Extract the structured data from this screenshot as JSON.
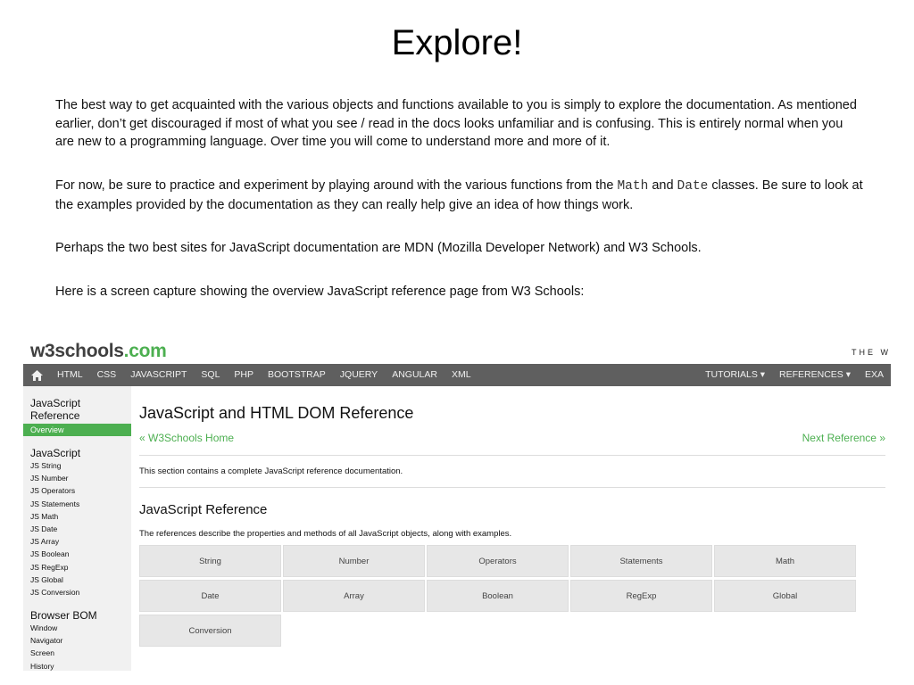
{
  "slide": {
    "title": "Explore!",
    "p1": "The best way to get acquainted with the various objects and functions available to you is simply to explore the documentation. As mentioned earlier, don’t get discouraged if most of what you see / read in the docs looks unfamiliar and is confusing. This is entirely normal when you are new to a programming language. Over time you will come to understand more and more of it.",
    "p2_before": "For now, be sure to practice and experiment by playing around with the various functions from the ",
    "p2_code1": "Math",
    "p2_and": " and ",
    "p2_code2": "Date",
    "p2_after": " classes. Be sure to look at the examples provided by the documentation as they can really help give an idea of how things work.",
    "p3": "Perhaps the two best sites for JavaScript documentation are MDN (Mozilla Developer Network) and W3 Schools.",
    "p4": "Here is a screen capture showing the overview JavaScript reference page from W3 Schools:"
  },
  "w3": {
    "logo_main": "w3schools",
    "logo_tld": ".com",
    "tagline": "THE W",
    "nav_left": [
      "HTML",
      "CSS",
      "JAVASCRIPT",
      "SQL",
      "PHP",
      "BOOTSTRAP",
      "JQUERY",
      "ANGULAR",
      "XML"
    ],
    "nav_right": [
      "TUTORIALS ▾",
      "REFERENCES ▾",
      "EXA"
    ],
    "accent_color": "#4CAF50",
    "sidebar": {
      "heading": "JavaScript Reference",
      "active": "Overview",
      "section1": "JavaScript",
      "items1": [
        "JS String",
        "JS Number",
        "JS Operators",
        "JS Statements",
        "JS Math",
        "JS Date",
        "JS Array",
        "JS Boolean",
        "JS RegExp",
        "JS Global",
        "JS Conversion"
      ],
      "section2": "Browser BOM",
      "items2": [
        "Window",
        "Navigator",
        "Screen",
        "History"
      ]
    },
    "main": {
      "title": "JavaScript and HTML DOM Reference",
      "home_link": "« W3Schools Home",
      "next_link": "Next Reference »",
      "intro": "This section contains a complete JavaScript reference documentation.",
      "subtitle": "JavaScript Reference",
      "desc": "The references describe the properties and methods of all JavaScript objects, along with examples.",
      "buttons": [
        "String",
        "Number",
        "Operators",
        "Statements",
        "Math",
        "Date",
        "Array",
        "Boolean",
        "RegExp",
        "Global",
        "Conversion"
      ]
    }
  }
}
